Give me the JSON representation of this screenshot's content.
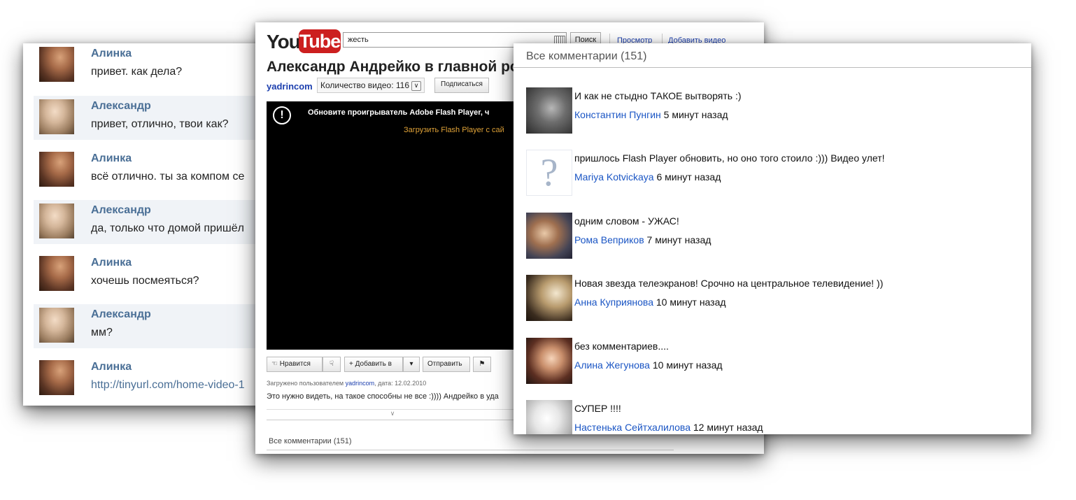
{
  "chat": {
    "messages": [
      {
        "name": "Алинка",
        "text": "привет. как дела?"
      },
      {
        "name": "Александр",
        "text": "привет, отлично, твои как?"
      },
      {
        "name": "Алинка",
        "text": "всё отлично. ты за компом се"
      },
      {
        "name": "Александр",
        "text": "да, только что домой пришёл"
      },
      {
        "name": "Алинка",
        "text": "хочешь посмеяться?"
      },
      {
        "name": "Александр",
        "text": "мм?"
      },
      {
        "name": "Алинка",
        "text": "http://tinyurl.com/home-video-1"
      }
    ]
  },
  "youtube": {
    "logo_you": "You",
    "logo_tube": "Tube",
    "search_value": "жесть",
    "search_button": "Поиск",
    "nav_browse": "Просмотр",
    "nav_upload": "Добавить видео",
    "title": "Александр Андрейко в главной рол",
    "channel": "yadrincom",
    "video_count": "Количество видео: 116",
    "subscribe": "Подписаться",
    "flash_message": "Обновите проигрыватель Adobe Flash Player, ч",
    "flash_link": "Загрузить Flash Player с сай",
    "like_button": "Нравится",
    "add_to_button": "Добавить в",
    "share_button": "Отправить",
    "uploaded_prefix": "Загружено пользователем",
    "uploaded_channel": "yadrincom",
    "uploaded_date": ", дата: 12.02.2010",
    "description": "Это нужно видеть, на такое способны не все :)))) Андрейко в уда",
    "comments_heading": "Все комментарии (151)"
  },
  "comments": {
    "heading": "Все комментарии (151)",
    "items": [
      {
        "text": "И как не стыдно ТАКОЕ вытворять :)",
        "author": "Константин Пунгин",
        "time": "5 минут назад"
      },
      {
        "text": "пришлось Flash Player обновить, но оно того стоило :))) Видео улет!",
        "author": "Mariya Kotvickaya",
        "time": "6 минут назад",
        "avatar": "?"
      },
      {
        "text": "одним словом - УЖАС!",
        "author": "Рома Веприков",
        "time": "7 минут назад"
      },
      {
        "text": "Новая звезда телеэкранов! Срочно на центральное телевидение! ))",
        "author": "Анна Куприянова",
        "time": "10 минут назад"
      },
      {
        "text": "без комментариев....",
        "author": "Алина Жегунова",
        "time": "10 минут назад"
      },
      {
        "text": "СУПЕР !!!!",
        "author": "Настенька Сейтхалилова",
        "time": "12 минут назад"
      }
    ]
  },
  "colors": {
    "chat_name": "#4a6f96",
    "youtube_red": "#cc1f1f",
    "link_blue": "#1c3fae",
    "comment_author": "#1a55c4"
  }
}
